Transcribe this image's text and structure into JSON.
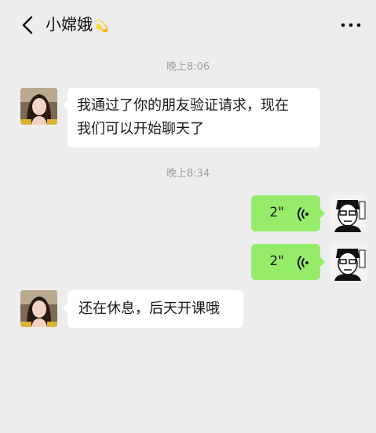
{
  "header": {
    "contact_name": "小嫦娥",
    "name_emoji": "💫"
  },
  "messages": [
    {
      "type": "time",
      "text": "晚上8:06"
    },
    {
      "type": "text",
      "side": "left",
      "lines": [
        "我通过了你的朋友验证请求，现在",
        "我们可以开始聊天了"
      ]
    },
    {
      "type": "time",
      "text": "晚上8:34"
    },
    {
      "type": "voice",
      "side": "right",
      "duration": "2\""
    },
    {
      "type": "voice",
      "side": "right",
      "duration": "2\""
    },
    {
      "type": "text",
      "side": "left",
      "lines": [
        "还在休息，后天开课哦"
      ]
    }
  ],
  "colors": {
    "background": "#ededed",
    "incoming_bubble": "#ffffff",
    "outgoing_bubble": "#95ec69",
    "timestamp": "#a1a1a1"
  },
  "icons": {
    "back": "chevron-left-icon",
    "more": "ellipsis-icon",
    "voice": "voice-wave-icon"
  }
}
